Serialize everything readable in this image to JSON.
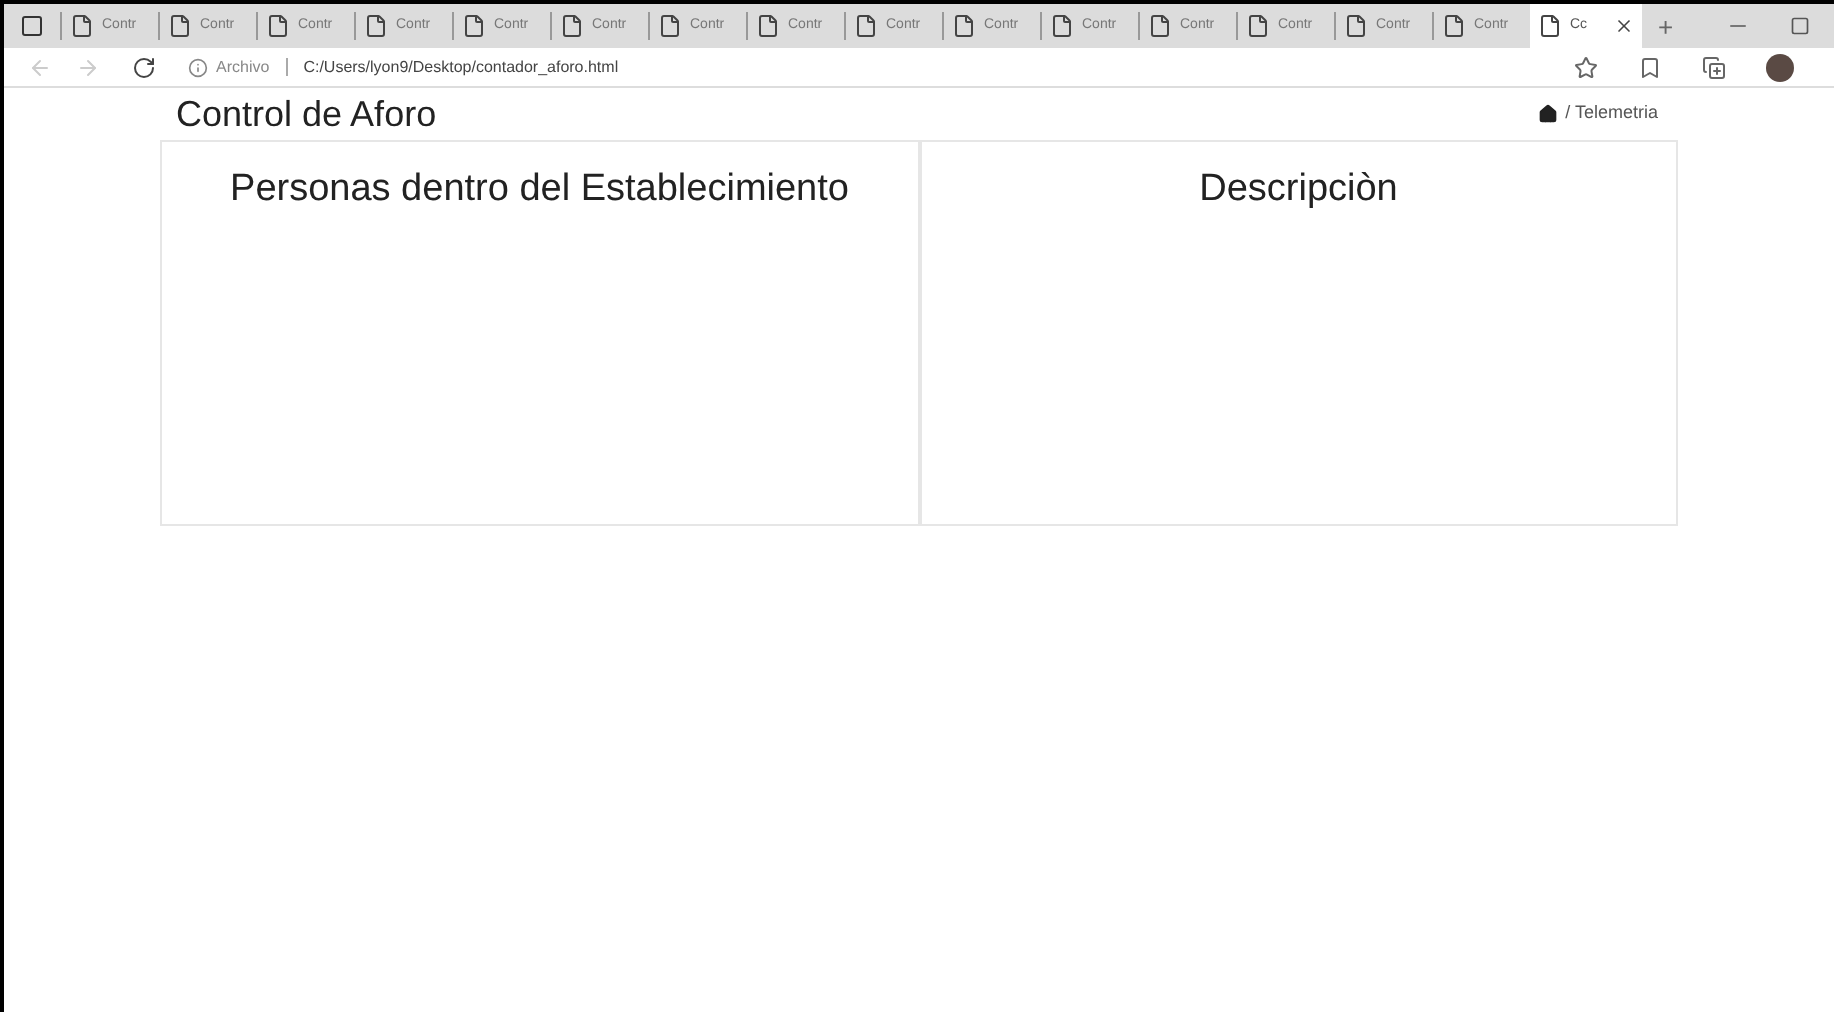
{
  "browser": {
    "tabs": [
      {
        "title": "Contr",
        "selected": false
      },
      {
        "title": "Contr",
        "selected": false
      },
      {
        "title": "Contr",
        "selected": false
      },
      {
        "title": "Contr",
        "selected": false
      },
      {
        "title": "Contr",
        "selected": false
      },
      {
        "title": "Contr",
        "selected": false
      },
      {
        "title": "Contr",
        "selected": false
      },
      {
        "title": "Contr",
        "selected": false
      },
      {
        "title": "Contr",
        "selected": false
      },
      {
        "title": "Contr",
        "selected": false
      },
      {
        "title": "Contr",
        "selected": false
      },
      {
        "title": "Contr",
        "selected": false
      },
      {
        "title": "Contr",
        "selected": false
      },
      {
        "title": "Contr",
        "selected": false
      },
      {
        "title": "Contr",
        "selected": false
      },
      {
        "title": "Cc",
        "selected": true
      }
    ],
    "new_tab": "+",
    "address": {
      "prefix": "Archivo",
      "url": "C:/Users/lyon9/Desktop/contador_aforo.html"
    }
  },
  "page": {
    "title": "Control de Aforo",
    "breadcrumb": "/ Telemetria",
    "panels": [
      {
        "heading": "Personas dentro del Establecimiento"
      },
      {
        "heading": "Descripciòn"
      }
    ]
  }
}
